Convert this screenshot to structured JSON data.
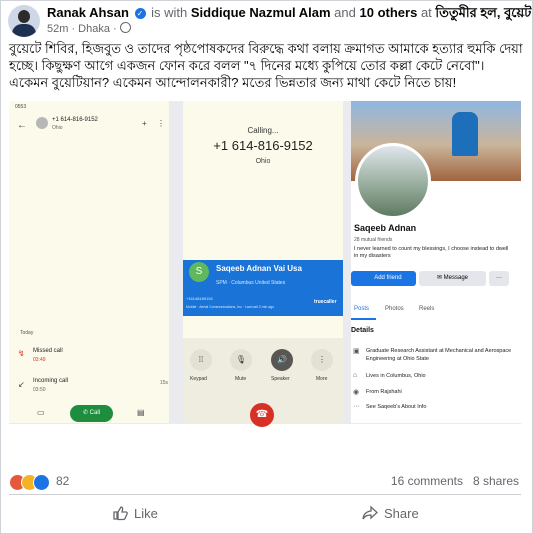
{
  "post": {
    "author": "Ranak Ahsan",
    "is_with": "is with",
    "tagged": "Siddique Nazmul Alam",
    "and_others": "and",
    "others": "10 others",
    "at": "at",
    "place": "তিতুমীর হল, বুয়েট।",
    "time": "52m · Dhaka ·",
    "text": "বুয়েটে শিবির, হিজবুত ও তাদের পৃষ্ঠপোষকদের বিরুদ্ধে কথা বলায় ক্রমাগত আমাকে হত্যার হুমকি দেয়া হচ্ছে। কিছুক্ষণ আগে একজন ফোন করে বলল \"৭ দিনের মধ্যে কুপিয়ে তোর কল্লা কেটে নেবো\"। একেমন বুয়েটিয়ান? একেমন আন্দোলনকারী? মতের ভিন্নতার জন্য মাথা কেটে নিতে চায়!"
  },
  "phone_log": {
    "status_time": "0553",
    "number": "+1 614-816-9152",
    "location": "Ohio",
    "today": "Today",
    "missed_label": "Missed call",
    "missed_time": "03:49",
    "incoming_label": "Incoming call",
    "incoming_time": "03:50",
    "duration": "15s",
    "call_label": "Call"
  },
  "calling": {
    "status": "Calling...",
    "number": "+1 614-816-9152",
    "location": "Ohio",
    "caller_name": "Saqeeb Adnan Vai Usa",
    "caller_initial": "S",
    "caller_meta": "SPM · Columbus United States",
    "caller_number": "+16148169152",
    "caller_carrier": "Mobile · Aerial Communications, Inc · Last call 2 min ago",
    "truecaller": "truecaller",
    "keypad": "Keypad",
    "mute": "Mute",
    "speaker": "Speaker",
    "more": "More"
  },
  "profile": {
    "name": "Saqeeb Adnan",
    "mutual": "28 mutual friends",
    "bio": "I never learned to count my blessings, I choose instead to dwell in my disasters",
    "add_friend": "Add friend",
    "message": "Message",
    "more": "···",
    "tabs": [
      "Posts",
      "Photos",
      "Reels"
    ],
    "details_title": "Details",
    "details": [
      "Graduate Research Assistant at Mechanical and Aerospace Engineering at Ohio State",
      "Lives in Columbus, Ohio",
      "From Rajshahi",
      "See Saqeeb's About Info"
    ]
  },
  "engagement": {
    "reactions": "82",
    "comments": "16 comments",
    "shares": "8 shares",
    "like": "Like",
    "share": "Share"
  },
  "colors": {
    "accent": "#1b74e4",
    "missed": "#d93025",
    "call_green": "#1e8e3e"
  }
}
